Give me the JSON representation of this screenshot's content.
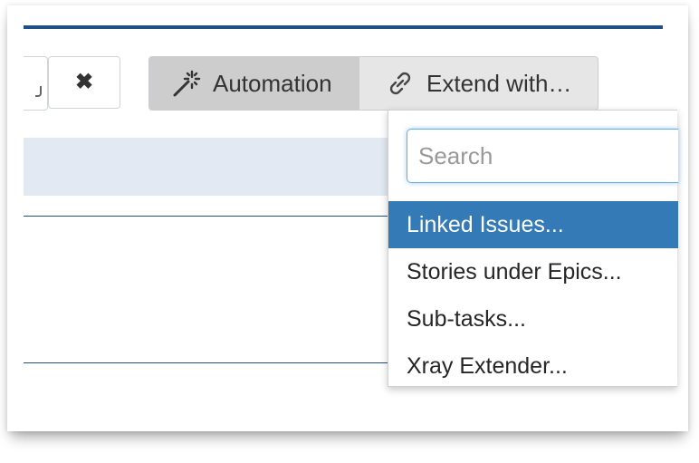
{
  "toolbar": {
    "close_icon": "close-icon",
    "automation_label": "Automation",
    "automation_icon": "magic-wand-icon",
    "extend_label": "Extend with…",
    "extend_icon": "link-icon"
  },
  "dropdown": {
    "search_placeholder": "Search",
    "search_value": "",
    "items": [
      {
        "label": "Linked Issues...",
        "active": true
      },
      {
        "label": "Stories under Epics...",
        "active": false
      },
      {
        "label": "Sub-tasks...",
        "active": false
      },
      {
        "label": "Xray Extender...",
        "active": false
      }
    ]
  },
  "colors": {
    "accent_bar": "#1f4f87",
    "selected_item": "#337ab7",
    "band": "#e3e9f2"
  }
}
